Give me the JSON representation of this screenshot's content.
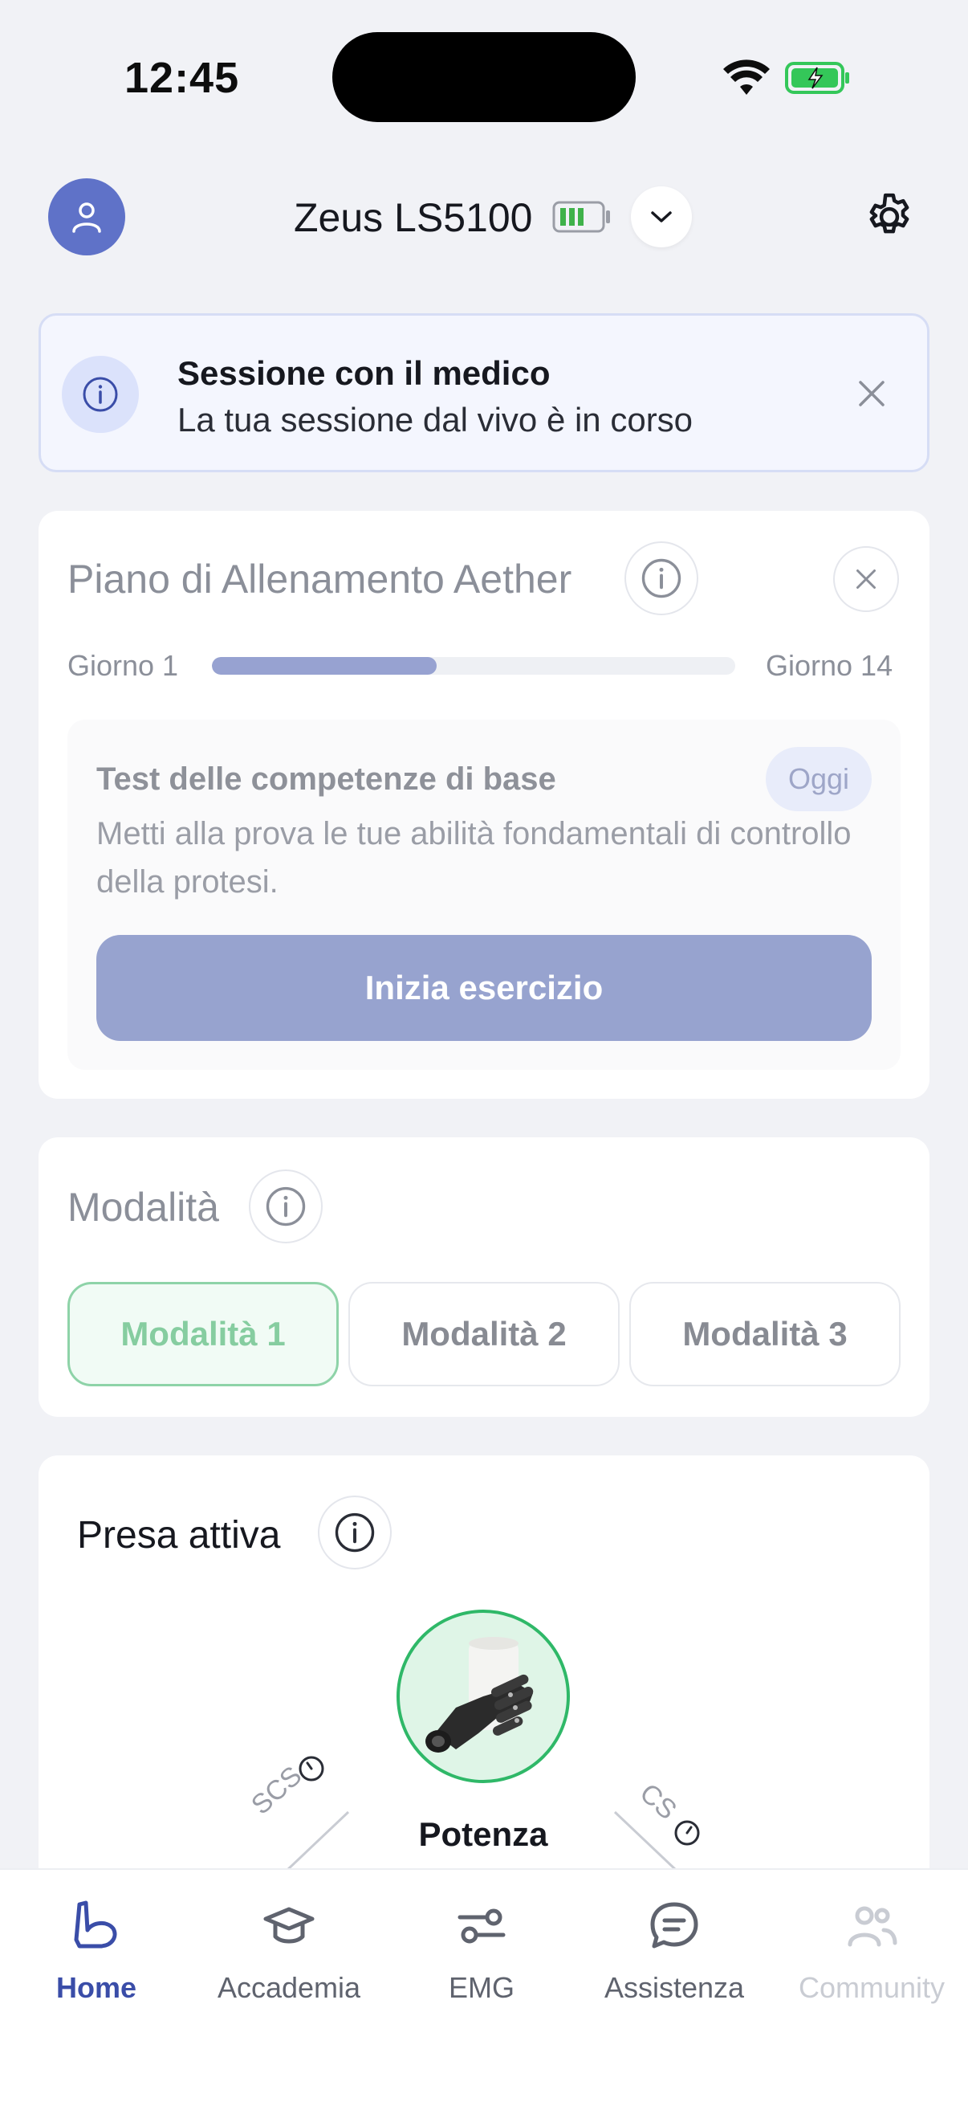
{
  "status_bar": {
    "time": "12:45"
  },
  "header": {
    "device_name": "Zeus LS5100",
    "avatar_icon": "user-icon",
    "battery_icon": "device-battery-icon",
    "dropdown_icon": "chevron-down-icon",
    "settings_icon": "gear-icon"
  },
  "banner": {
    "title": "Sessione con il medico",
    "text": "La tua sessione dal vivo è in corso",
    "icon": "info-icon",
    "close_icon": "close-icon"
  },
  "training": {
    "title": "Piano di Allenamento Aether",
    "day_start": "Giorno 1",
    "day_end": "Giorno 14",
    "progress_fraction": 0.43,
    "exercise": {
      "title": "Test delle competenze di base",
      "badge": "Oggi",
      "description": "Metti alla prova le tue abilità fondamentali di controllo della protesi.",
      "button": "Inizia esercizio"
    }
  },
  "modes": {
    "title": "Modalità",
    "items": [
      "Modalità 1",
      "Modalità 2",
      "Modalità 3"
    ],
    "active_index": 0
  },
  "grip": {
    "title": "Presa attiva",
    "name": "Potenza",
    "left_label": "SCS",
    "right_label": "CS"
  },
  "tabs": [
    {
      "label": "Home",
      "icon": "home-arm-icon",
      "state": "active"
    },
    {
      "label": "Accademia",
      "icon": "graduation-cap-icon",
      "state": "normal"
    },
    {
      "label": "EMG",
      "icon": "emg-slider-icon",
      "state": "normal"
    },
    {
      "label": "Assistenza",
      "icon": "chat-bubble-icon",
      "state": "normal"
    },
    {
      "label": "Community",
      "icon": "people-icon",
      "state": "disabled"
    }
  ],
  "colors": {
    "accent": "#3a4da8",
    "avatar": "#5f72c8",
    "active_mode": "#86cda0",
    "grip_ring": "#2fb868",
    "battery_green": "#34c759"
  }
}
